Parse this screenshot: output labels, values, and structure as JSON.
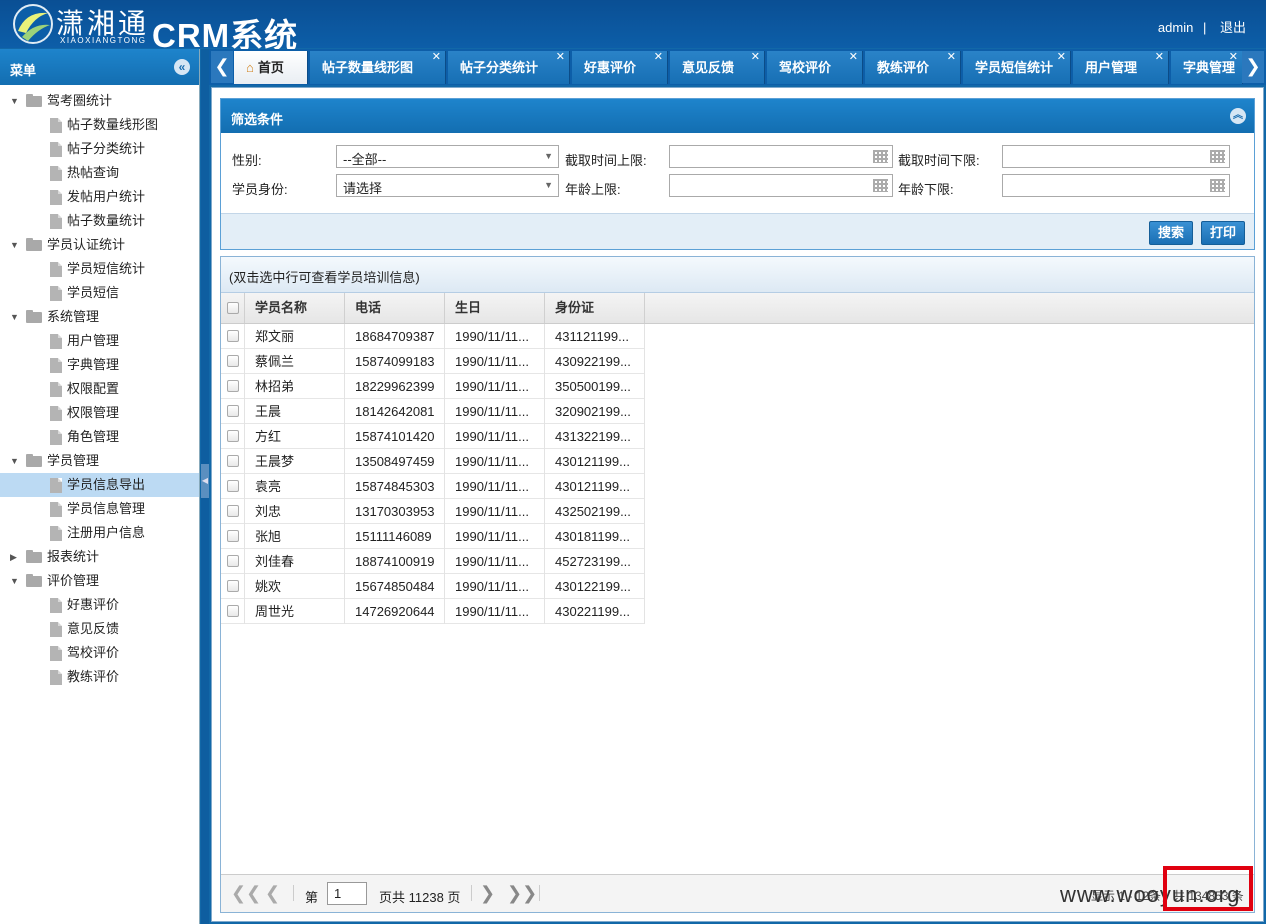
{
  "header": {
    "logo_cn": "潇湘通",
    "logo_en": "XIAOXIANGTONG",
    "app_title": "CRM系统",
    "user": "admin",
    "separator": "|",
    "logout": "退出"
  },
  "sidebar": {
    "title": "菜单",
    "collapse_icon": "«"
  },
  "menu": [
    {
      "label": "驾考圈统计",
      "children": [
        "帖子数量线形图",
        "帖子分类统计",
        "热帖查询",
        "发帖用户统计",
        "帖子数量统计"
      ]
    },
    {
      "label": "学员认证统计",
      "children": [
        "学员短信统计",
        "学员短信"
      ]
    },
    {
      "label": "系统管理",
      "children": [
        "用户管理",
        "字典管理",
        "权限配置",
        "权限管理",
        "角色管理"
      ]
    },
    {
      "label": "学员管理",
      "children": [
        "学员信息导出",
        "学员信息管理",
        "注册用户信息"
      ],
      "selected_child": "学员信息导出"
    },
    {
      "label": "报表统计",
      "children": [],
      "collapsed": true
    },
    {
      "label": "评价管理",
      "children": [
        "好惠评价",
        "意见反馈",
        "驾校评价",
        "教练评价"
      ]
    }
  ],
  "tabs": [
    {
      "label": "首页",
      "closable": false,
      "active": true,
      "icon": "home-icon"
    },
    {
      "label": "帖子数量线形图",
      "closable": true
    },
    {
      "label": "帖子分类统计",
      "closable": true
    },
    {
      "label": "好惠评价",
      "closable": true
    },
    {
      "label": "意见反馈",
      "closable": true
    },
    {
      "label": "驾校评价",
      "closable": true
    },
    {
      "label": "教练评价",
      "closable": true
    },
    {
      "label": "学员短信统计",
      "closable": true
    },
    {
      "label": "用户管理",
      "closable": true
    },
    {
      "label": "字典管理",
      "closable": true
    }
  ],
  "filter": {
    "title": "筛选条件",
    "gender_label": "性别:",
    "gender_value": "--全部--",
    "identity_label": "学员身份:",
    "identity_value": "请选择",
    "deadline_upper_label": "截取时间上限:",
    "deadline_lower_label": "截取时间下限:",
    "age_upper_label": "年龄上限:",
    "age_lower_label": "年龄下限:",
    "search_button": "搜索",
    "print_button": "打印"
  },
  "grid": {
    "title": "(双击选中行可查看学员培训信息)",
    "columns": [
      "学员名称",
      "电话",
      "生日",
      "身份证"
    ],
    "rows": [
      [
        "郑文丽",
        "18684709387",
        "1990/11/11...",
        "431121199..."
      ],
      [
        "蔡佩兰",
        "15874099183",
        "1990/11/11...",
        "430922199..."
      ],
      [
        "林招弟",
        "18229962399",
        "1990/11/11...",
        "350500199..."
      ],
      [
        "王晨",
        "18142642081",
        "1990/11/11...",
        "320902199..."
      ],
      [
        "方红",
        "15874101420",
        "1990/11/11...",
        "431322199..."
      ],
      [
        "王晨梦",
        "13508497459",
        "1990/11/11...",
        "430121199..."
      ],
      [
        "袁亮",
        "15874845303",
        "1990/11/11...",
        "430121199..."
      ],
      [
        "刘忠",
        "13170303953",
        "1990/11/11...",
        "432502199..."
      ],
      [
        "张旭",
        "15111146089",
        "1990/11/11...",
        "430181199..."
      ],
      [
        "刘佳春",
        "18874100919",
        "1990/11/11...",
        "452723199..."
      ],
      [
        "姚欢",
        "15674850484",
        "1990/11/11...",
        "430122199..."
      ],
      [
        "周世光",
        "14726920644",
        "1990/11/11...",
        "430221199..."
      ]
    ]
  },
  "pager": {
    "page_prefix": "第",
    "page_value": "1",
    "page_suffix": "页共 11238 页",
    "summary": "显示 1 - 12条，共 134853 条"
  },
  "watermark": "www.wooyun.org"
}
